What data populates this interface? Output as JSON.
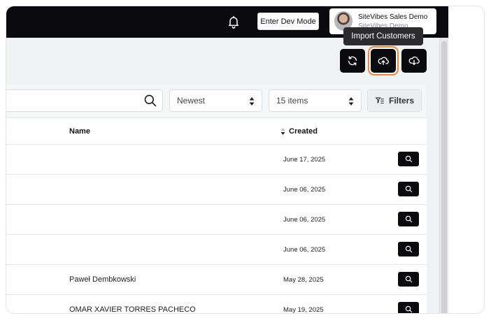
{
  "topbar": {
    "bell_icon": "bell-icon",
    "dev_button_label": "Enter Dev Mode",
    "user": {
      "name": "SiteVibes Sales Demo",
      "subtitle": "SiteVibes Demo"
    }
  },
  "toolbar": {
    "tooltip": "Import Customers",
    "buttons": [
      {
        "icon": "refresh-icon"
      },
      {
        "icon": "cloud-upload-icon"
      },
      {
        "icon": "cloud-download-icon"
      }
    ]
  },
  "filters": {
    "search_value": "",
    "sort_value": "Newest",
    "page_size_value": "15 items",
    "filters_label": "Filters"
  },
  "table": {
    "columns": {
      "name": "Name",
      "created": "Created"
    },
    "rows": [
      {
        "name": "",
        "created": "June 17, 2025"
      },
      {
        "name": "",
        "created": "June 06, 2025"
      },
      {
        "name": "",
        "created": "June 06, 2025"
      },
      {
        "name": "",
        "created": "June 06, 2025"
      },
      {
        "name": "Paweł Dembkowski",
        "created": "May 28, 2025"
      },
      {
        "name": "OMAR XAVIER TORRES PACHECO",
        "created": "May 19, 2025"
      }
    ]
  },
  "colors": {
    "topbar": "#0b0b0f",
    "active_outline": "#f0843c",
    "panel": "#f1f2f4"
  }
}
